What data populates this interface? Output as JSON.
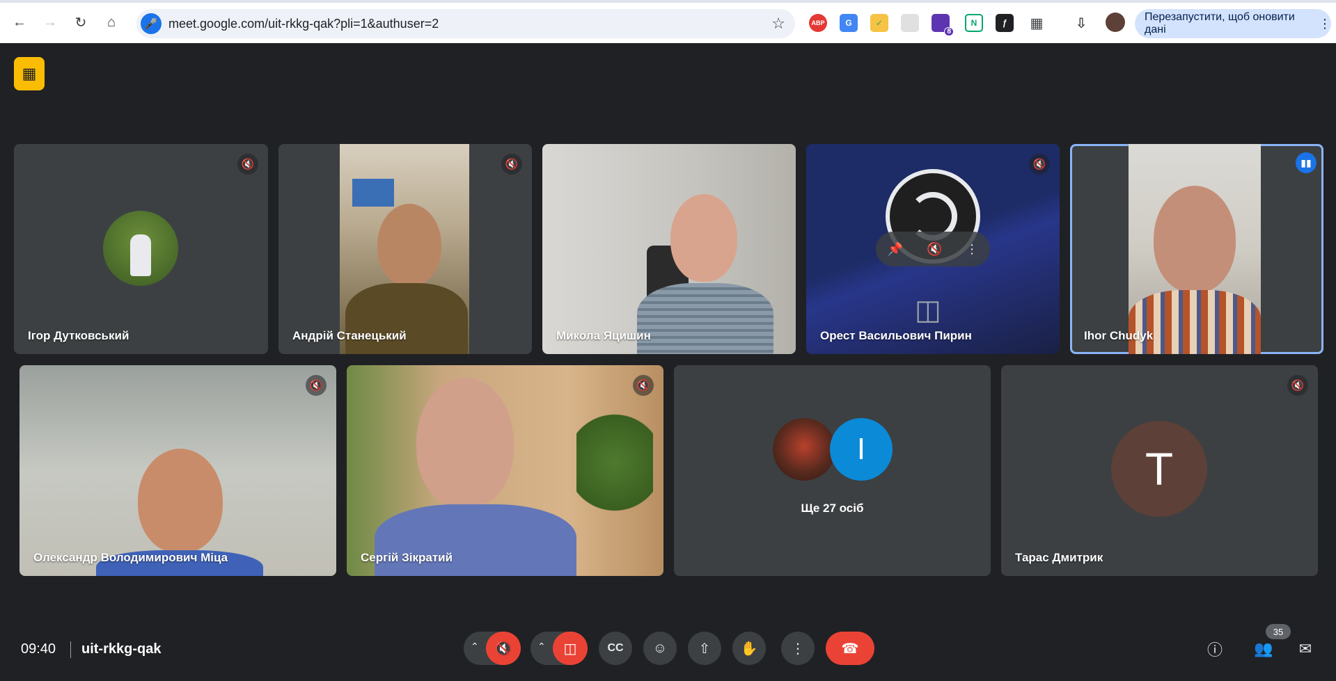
{
  "browser": {
    "url": "meet.google.com/uit-rkkg-qak?pli=1&authuser=2",
    "restart_label": "Перезапустити, щоб оновити дані",
    "extensions": [
      "ABP",
      "N",
      "ƒ",
      "8"
    ]
  },
  "tiles_top": [
    {
      "name": "Ігор Дутковський",
      "muted": true
    },
    {
      "name": "Андрій Станецький",
      "muted": true
    },
    {
      "name": "Микола Яцишин",
      "muted": false
    },
    {
      "name": "Орест Васильович Пирин",
      "muted": true
    },
    {
      "name": "Ihor Chudyk",
      "muted": false,
      "speaking": true
    }
  ],
  "tiles_bottom": [
    {
      "name": "Олександр Володимирович Міца",
      "muted": true
    },
    {
      "name": "Сергій Зікратий",
      "muted": true
    },
    {
      "name": "Ще 27 осіб",
      "avatar_letter": "I"
    },
    {
      "name": "Тарас Дмитрик",
      "muted": true,
      "avatar_letter": "T"
    }
  ],
  "bottom_bar": {
    "time": "09:40",
    "meeting_code": "uit-rkkg-qak",
    "participants_count": "35"
  },
  "colors": {
    "background": "#202124",
    "tile": "#3c4043",
    "red": "#ea4335",
    "speaking": "#8ab4f8",
    "recording_badge": "#fbbc04"
  }
}
